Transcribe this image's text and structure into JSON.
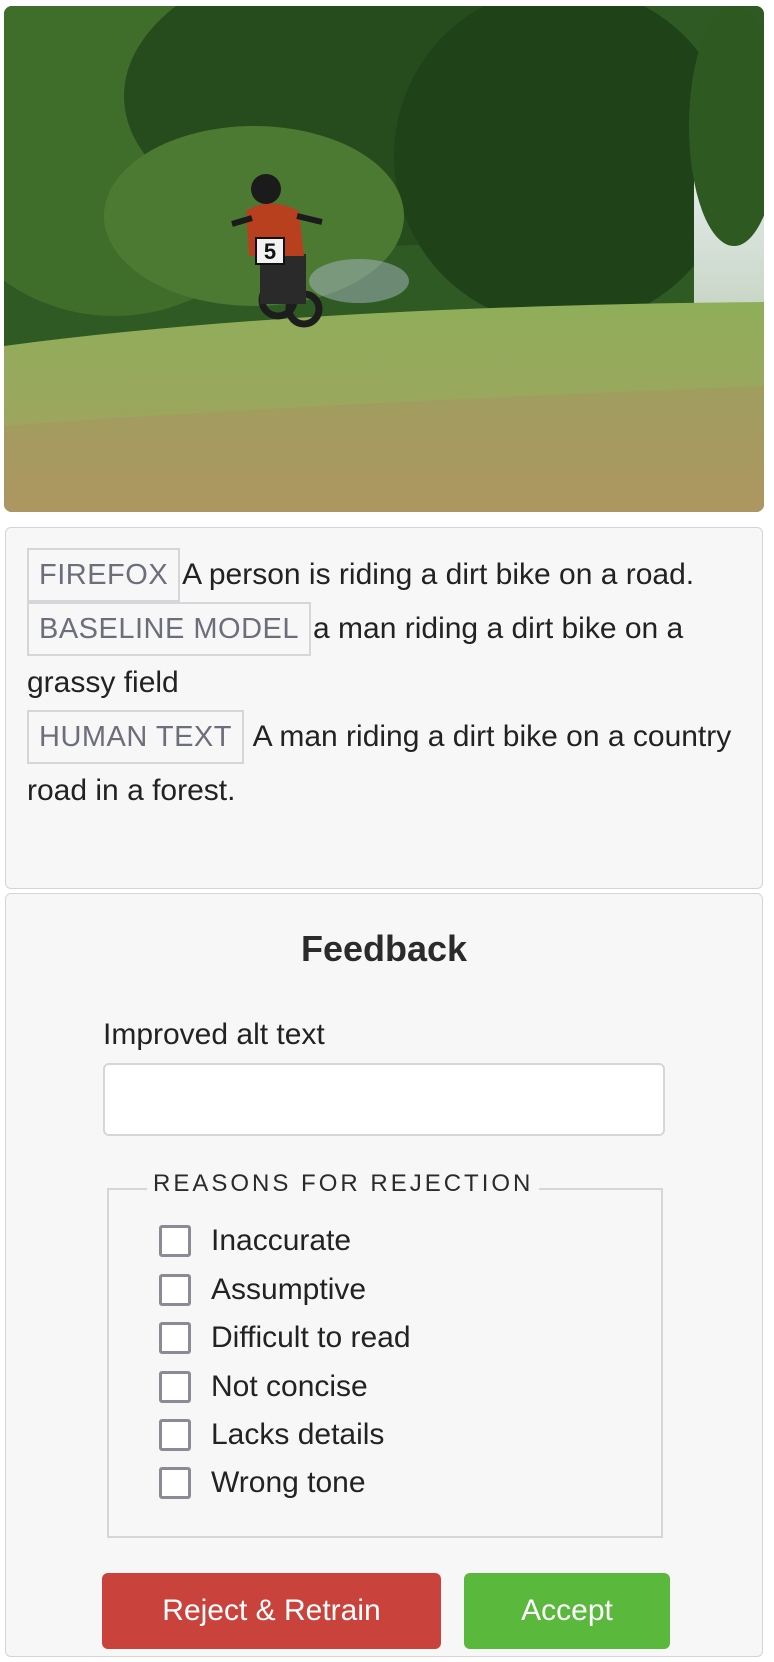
{
  "image": {
    "bib_number": "5"
  },
  "captions": [
    {
      "tag": "FIREFOX",
      "text": "A person is riding a dirt bike on a road."
    },
    {
      "tag": "BASELINE MODEL",
      "text": "a man riding a dirt bike on a grassy field"
    },
    {
      "tag": "HUMAN TEXT",
      "text": " A man riding a dirt bike on a country road in a forest."
    }
  ],
  "feedback": {
    "title": "Feedback",
    "alt_label": "Improved alt text",
    "alt_value": "",
    "reasons_legend": "REASONS FOR REJECTION",
    "reasons": [
      {
        "label": "Inaccurate",
        "checked": false
      },
      {
        "label": "Assumptive",
        "checked": false
      },
      {
        "label": "Difficult to read",
        "checked": false
      },
      {
        "label": "Not concise",
        "checked": false
      },
      {
        "label": "Lacks details",
        "checked": false
      },
      {
        "label": "Wrong tone",
        "checked": false
      }
    ],
    "reject_label": "Reject & Retrain",
    "accept_label": "Accept"
  },
  "colors": {
    "reject": "#c9433c",
    "accept": "#5ab83d",
    "panel_bg": "#f7f7f8",
    "border": "#d4d4d8"
  }
}
